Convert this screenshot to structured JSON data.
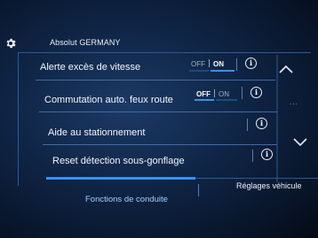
{
  "status_bar": {
    "title": "Absolut GERMANY",
    "settings_icon": "gear-icon"
  },
  "settings_list": {
    "rows": [
      {
        "label": "Alerte excès de vitesse",
        "toggle": {
          "off_label": "OFF",
          "on_label": "ON",
          "state": "on"
        },
        "info_icon": "info-icon"
      },
      {
        "label": "Commutation auto. feux route",
        "toggle": {
          "off_label": "OFF",
          "on_label": "ON",
          "state": "off"
        },
        "info_icon": "info-icon"
      },
      {
        "label": "Aide au stationnement",
        "info_icon": "info-icon"
      },
      {
        "label": "Reset détection sous-gonflage",
        "info_icon": "info-icon"
      }
    ],
    "more_indicator": "..."
  },
  "scroll": {
    "up_icon": "chevron-up-icon",
    "down_icon": "chevron-down-icon"
  },
  "tabs": [
    {
      "label": "Fonctions de conduite",
      "active": true
    },
    {
      "label": "Réglages véhicule",
      "active": false
    }
  ],
  "colors": {
    "accent": "#3a92ee",
    "background": "#0f2444",
    "active_tab_text": "#9fd0ff"
  }
}
